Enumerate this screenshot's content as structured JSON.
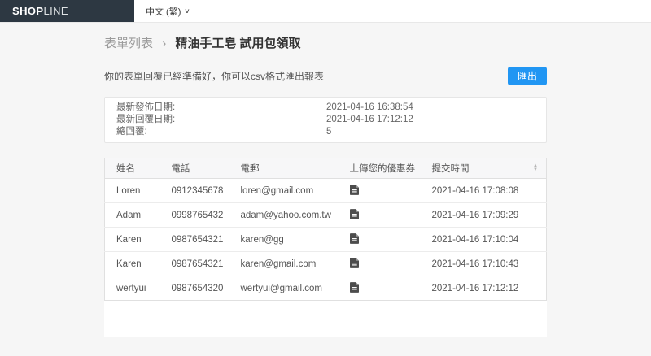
{
  "topbar": {
    "logo": {
      "bold": "SHOP",
      "light": "LINE"
    },
    "language": {
      "label": "中文 (繁)"
    }
  },
  "icons": {
    "caret_down": "∨",
    "sort_up": "▲",
    "sort_down": "▼"
  },
  "breadcrumb": {
    "parent": "表單列表",
    "separator": "›",
    "current": "精油手工皂 試用包領取"
  },
  "export_section": {
    "description": "你的表單回覆已經準備好，你可以csv格式匯出報表",
    "button_label": "匯出",
    "button_color": "#2196f3"
  },
  "summary": {
    "rows": [
      {
        "label": "最新發佈日期:",
        "value": "2021-04-16 16:38:54"
      },
      {
        "label": "最新回覆日期:",
        "value": "2021-04-16 17:12:12"
      },
      {
        "label": "總回覆:",
        "value": "5"
      }
    ]
  },
  "table": {
    "columns": [
      "姓名",
      "電話",
      "電郵",
      "上傳您的優惠券",
      "提交時間"
    ],
    "rows": [
      {
        "name": "Loren",
        "phone": "0912345678",
        "email": "loren@gmail.com",
        "submitted_at": "2021-04-16 17:08:08"
      },
      {
        "name": "Adam",
        "phone": "0998765432",
        "email": "adam@yahoo.com.tw",
        "submitted_at": "2021-04-16 17:09:29"
      },
      {
        "name": "Karen",
        "phone": "0987654321",
        "email": "karen@gg",
        "submitted_at": "2021-04-16 17:10:04"
      },
      {
        "name": "Karen",
        "phone": "0987654321",
        "email": "karen@gmail.com",
        "submitted_at": "2021-04-16 17:10:43"
      },
      {
        "name": "wertyui",
        "phone": "0987654320",
        "email": "wertyui@gmail.com",
        "submitted_at": "2021-04-16 17:12:12"
      }
    ]
  },
  "colors": {
    "navbar_dark": "#2d3842",
    "primary_blue": "#2196f3",
    "page_background": "#f6f6f6"
  }
}
